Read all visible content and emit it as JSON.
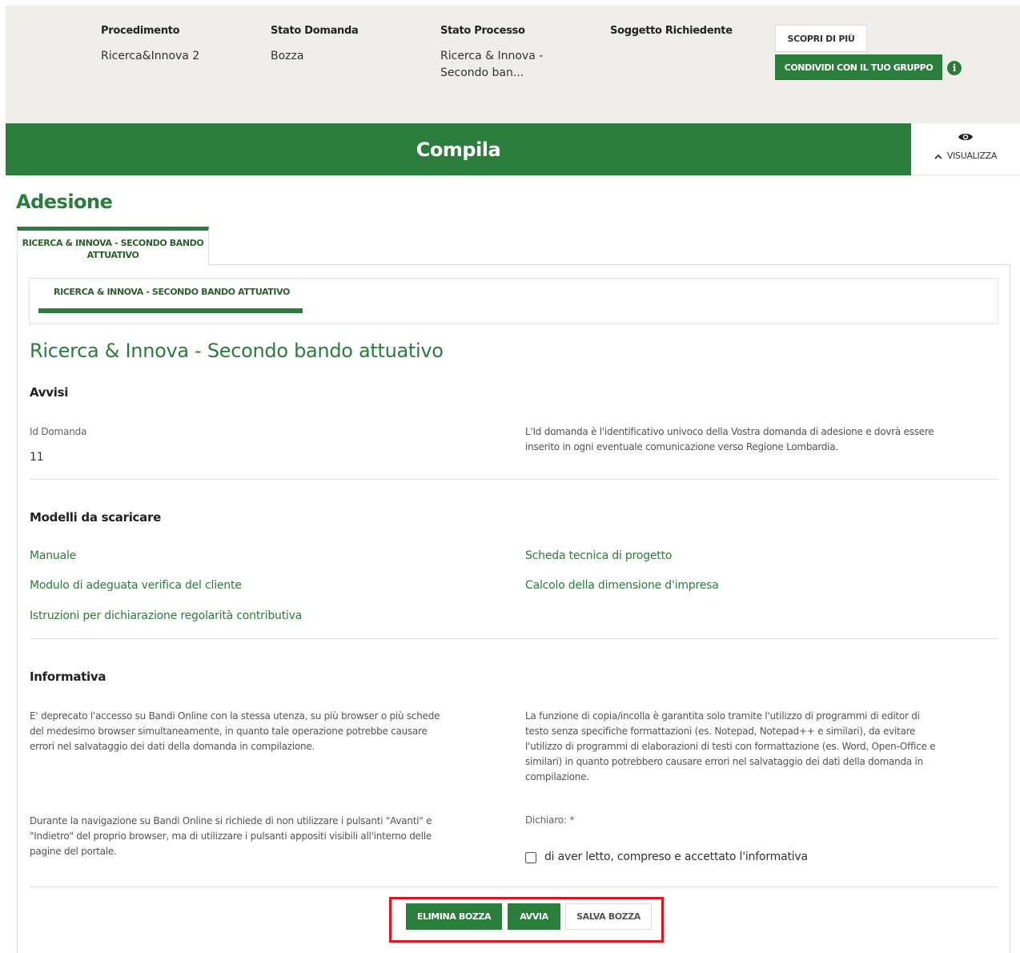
{
  "header": {
    "columns": [
      {
        "label": "Procedimento",
        "value": "Ricerca&Innova 2"
      },
      {
        "label": "Stato Domanda",
        "value": "Bozza"
      },
      {
        "label": "Stato Processo",
        "value_line1": "Ricerca & Innova -",
        "value_line2": "Secondo ban..."
      },
      {
        "label": "Soggetto Richiedente",
        "value": ""
      }
    ],
    "scopri_label": "SCOPRI DI PIÙ",
    "condividi_label": "CONDIVIDI CON IL TUO GRUPPO",
    "info_glyph": "i"
  },
  "bar": {
    "title": "Compila",
    "visualizza_label": "VISUALIZZA",
    "chevron": "^"
  },
  "page": {
    "heading": "Adesione",
    "outer_tab_line1": "RICERCA & INNOVA - SECONDO BANDO",
    "outer_tab_line2": "ATTUATIVO",
    "inner_tab": "RICERCA & INNOVA - SECONDO BANDO ATTUATIVO",
    "section_title": "Ricerca & Innova - Secondo bando attuativo"
  },
  "avvisi": {
    "heading": "Avvisi",
    "id_label": "Id Domanda",
    "id_value": "11",
    "note_line1": "L'Id domanda è l'identificativo univoco della Vostra domanda di adesione e dovrà essere",
    "note_line2": "inserito in ogni eventuale comunicazione verso Regione Lombardia."
  },
  "modelli": {
    "heading": "Modelli da scaricare",
    "links": [
      "Manuale",
      "Scheda tecnica di progetto",
      "Modulo di adeguata verifica del cliente",
      "Calcolo della dimensione d'impresa",
      "Istruzioni per dichiarazione regolarità contributiva"
    ]
  },
  "informativa": {
    "heading": "Informativa",
    "left1": [
      "E' deprecato l'accesso su Bandi Online con la stessa utenza, su più browser o più schede",
      "del medesimo browser simultaneamente, in quanto tale operazione potrebbe causare",
      "errori nel salvataggio dei dati della domanda in compilazione."
    ],
    "right1": [
      "La funzione di copia/incolla è garantita solo tramite l'utilizzo di programmi di editor di",
      "testo senza specifiche formattazioni (es. Notepad, Notepad++ e similari), da evitare",
      "l'utilizzo di programmi di elaborazioni di testi con formattazione (es. Word, Open-Office e",
      "similari) in quanto potrebbero causare errori nel salvataggio dei dati della domanda in",
      "compilazione."
    ],
    "left2": [
      "Durante la navigazione su Bandi Online si richiede di non utilizzare i pulsanti \"Avanti\" e",
      "\"Indietro\" del proprio browser, ma di utilizzare i pulsanti appositi visibili all'interno delle",
      "pagine del portale."
    ],
    "dichiaro_label": "Dichiaro: *",
    "checkbox_label": "di aver letto, compreso e accettato l'informativa"
  },
  "actions": {
    "elimina": "ELIMINA BOZZA",
    "avvia": "AVVIA",
    "salva": "SALVA BOZZA"
  },
  "colors": {
    "brand_green": "#2b7d3c",
    "band_bg": "#efeeeb",
    "highlight_red": "#e0141e"
  }
}
